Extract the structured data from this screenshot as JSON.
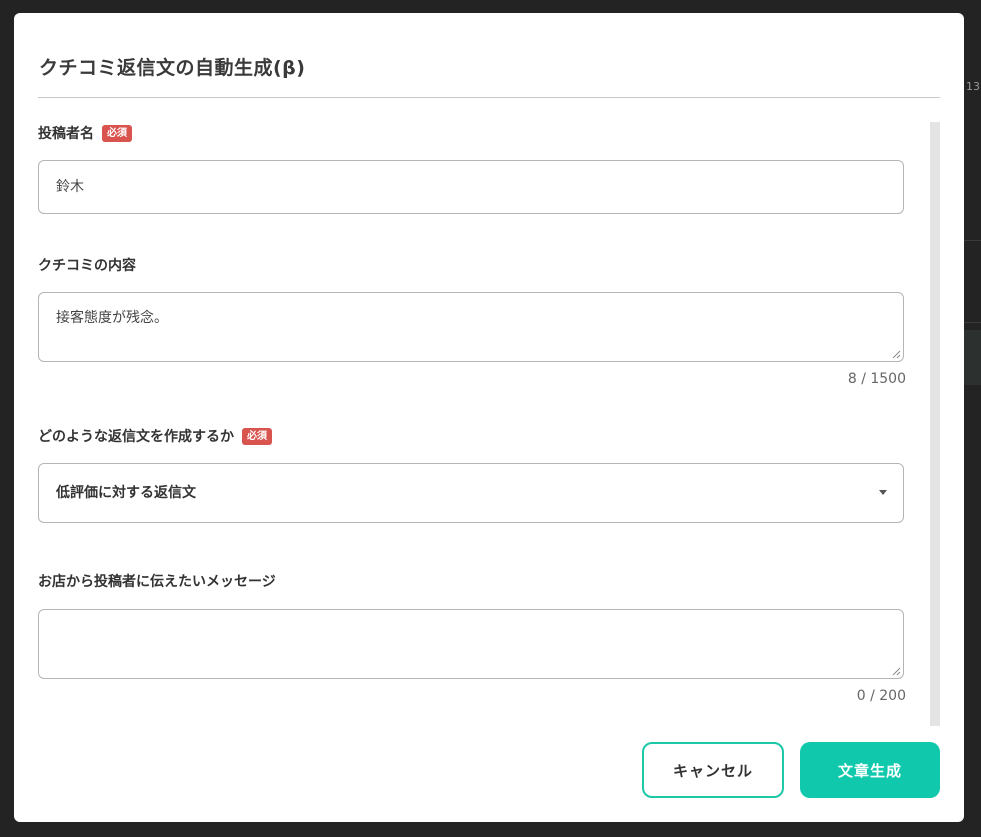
{
  "backdrop": {
    "edge_text": "13"
  },
  "modal": {
    "title": "クチコミ返信文の自動生成(β)"
  },
  "form": {
    "poster_name": {
      "label": "投稿者名",
      "required_badge": "必須",
      "value": "鈴木"
    },
    "review_content": {
      "label": "クチコミの内容",
      "value": "接客態度が残念。",
      "counter": "8 / 1500"
    },
    "reply_type": {
      "label": "どのような返信文を作成するか",
      "required_badge": "必須",
      "selected": "低評価に対する返信文"
    },
    "store_message": {
      "label": "お店から投稿者に伝えたいメッセージ",
      "value": "",
      "counter": "0 / 200"
    }
  },
  "buttons": {
    "cancel_label": "キャンセル",
    "generate_label": "文章生成"
  },
  "colors": {
    "accent": "#10c9ad",
    "required_badge": "#d9534f",
    "backdrop": "#232323"
  },
  "icons": {
    "select_caret": "caret-down-icon",
    "textarea_resize": "resize-grip-icon"
  }
}
